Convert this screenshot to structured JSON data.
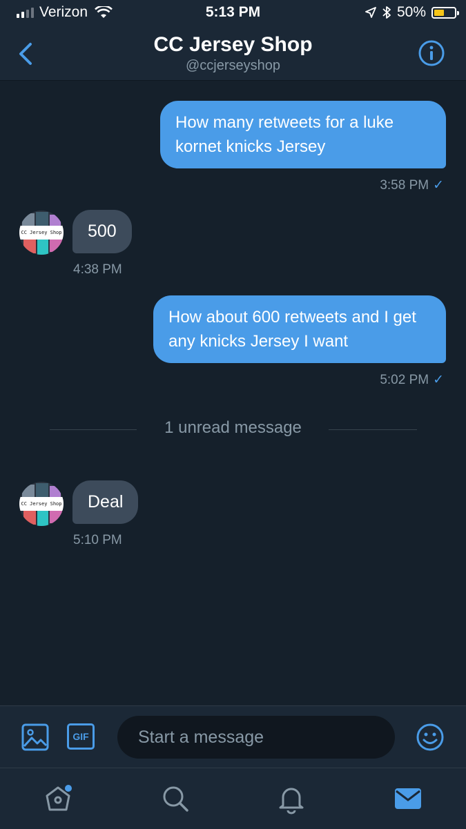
{
  "status_bar": {
    "carrier": "Verizon",
    "time": "5:13 PM",
    "battery": "50%",
    "battery_level": 0.5
  },
  "header": {
    "title": "CC Jersey Shop",
    "handle": "@ccjerseyshop"
  },
  "messages": [
    {
      "direction": "sent",
      "text": "How many retweets for a luke kornet knicks Jersey",
      "time": "3:58 PM",
      "read_mark": "✓"
    },
    {
      "direction": "received",
      "text": "500",
      "time": "4:38 PM"
    },
    {
      "direction": "sent",
      "text": "How about 600 retweets and I get any knicks Jersey I want",
      "time": "5:02 PM",
      "read_mark": "✓"
    },
    {
      "direction": "received",
      "text": "Deal",
      "time": "5:10 PM"
    }
  ],
  "avatar_label": "CC Jersey Shop",
  "unread_divider": "1 unread message",
  "composer": {
    "placeholder": "Start a message",
    "gif_label": "GIF"
  },
  "tabs": [
    "home",
    "search",
    "notifications",
    "messages"
  ],
  "colors": {
    "background": "#15202b",
    "bar": "#1b2836",
    "accent": "#4a9ce8",
    "received_bubble": "#3d4b5b",
    "muted": "#8899a6"
  }
}
